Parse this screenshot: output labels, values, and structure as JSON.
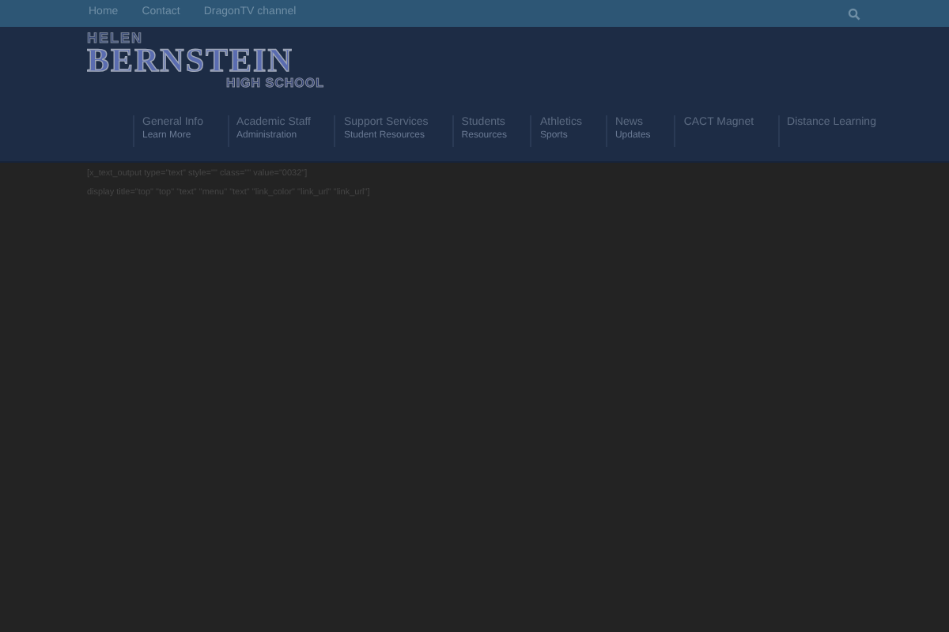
{
  "top_bar": {
    "links": [
      "Home",
      "Contact",
      "DragonTV channel"
    ]
  },
  "logo": {
    "line_1": "HELEN",
    "line_2": "BERNSTEIN",
    "line_3": "HIGH SCHOOL"
  },
  "nav": [
    {
      "label": "General Info",
      "sub": "Learn More"
    },
    {
      "label": "Academic Staff",
      "sub": "Administration"
    },
    {
      "label": "Support Services",
      "sub": "Student Resources"
    },
    {
      "label": "Students",
      "sub": "Resources"
    },
    {
      "label": "Athletics",
      "sub": "Sports"
    },
    {
      "label": "News",
      "sub": "Updates"
    },
    {
      "label": "CACT Magnet"
    },
    {
      "label": "Distance Learning"
    }
  ],
  "content": [
    "[x_text_output type=\"text\" style=\"\" class=\"\" value=\"0032\"]",
    "display title=\"top\" \"top\" \"text\" \"menu\" \"text\" \"link_color\" \"link_url\" \"link_url\"]"
  ]
}
